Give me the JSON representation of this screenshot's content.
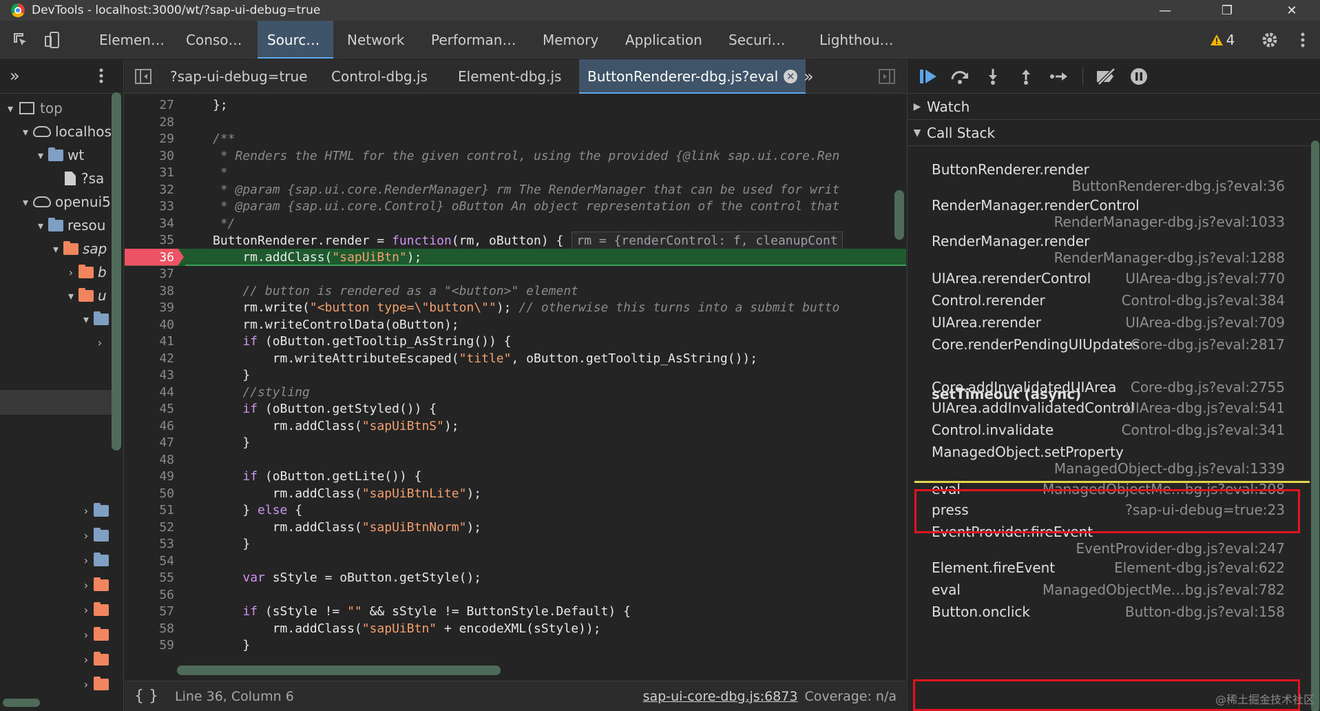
{
  "window": {
    "title": "DevTools - localhost:3000/wt/?sap-ui-debug=true",
    "controls": [
      "—",
      "❐",
      "✕"
    ]
  },
  "panel_tabs": [
    {
      "label": "Elemen…",
      "active": false
    },
    {
      "label": "Conso…",
      "active": false
    },
    {
      "label": "Sourc…",
      "active": true
    },
    {
      "label": "Network",
      "active": false
    },
    {
      "label": "Performan…",
      "active": false
    },
    {
      "label": "Memory",
      "active": false
    },
    {
      "label": "Application",
      "active": false
    },
    {
      "label": "Securi…",
      "active": false
    },
    {
      "label": "Lighthou…",
      "active": false
    }
  ],
  "warnings": {
    "icon": "warning-icon",
    "count": "4",
    "color": "#f4b400"
  },
  "navigator": {
    "more": "»",
    "tree": [
      {
        "label": "top",
        "icon": "frame-icon",
        "expanded": true
      },
      {
        "label": "localhos",
        "icon": "cloud-icon",
        "expanded": true
      },
      {
        "label": "wt",
        "icon": "folder-icon",
        "expanded": true
      },
      {
        "label": "?sa",
        "icon": "file-icon"
      },
      {
        "label": "openui5",
        "icon": "cloud-icon",
        "expanded": true
      },
      {
        "label": "resou",
        "icon": "folder-icon",
        "expanded": true
      },
      {
        "label": "sap",
        "icon": "folder-icon",
        "expanded": true
      },
      {
        "label": "b",
        "icon": "folder-icon",
        "expanded": false
      },
      {
        "label": "u",
        "icon": "folder-icon",
        "expanded": true
      }
    ]
  },
  "editor": {
    "tabs": [
      {
        "label": "?sap-ui-debug=true",
        "active": false
      },
      {
        "label": "Control-dbg.js",
        "active": false
      },
      {
        "label": "Element-dbg.js",
        "active": false
      },
      {
        "label": "ButtonRenderer-dbg.js?eval",
        "active": true
      }
    ],
    "more": "»",
    "status": {
      "braces": "{ }",
      "position": "Line 36, Column 6",
      "source_link": "sap-ui-core-dbg.js:6873",
      "coverage": "Coverage: n/a"
    }
  },
  "code": {
    "breakpoint_line": "36",
    "lines": [
      {
        "n": "27",
        "t": "};"
      },
      {
        "n": "28",
        "t": ""
      },
      {
        "n": "29",
        "t": "/**"
      },
      {
        "n": "30",
        "t": " * Renders the HTML for the given control, using the provided {@link sap.ui.core.Ren"
      },
      {
        "n": "31",
        "t": " *"
      },
      {
        "n": "32",
        "t": " * @param {sap.ui.core.RenderManager} rm The RenderManager that can be used for writ"
      },
      {
        "n": "33",
        "t": " * @param {sap.ui.core.Control} oButton An object representation of the control that"
      },
      {
        "n": "34",
        "t": " */"
      },
      {
        "n": "35",
        "t": "ButtonRenderer.render = function(rm, oButton) {"
      },
      {
        "n": "36",
        "t": "    rm.addClass(\"sapUiBtn\");"
      },
      {
        "n": "37",
        "t": ""
      },
      {
        "n": "38",
        "t": "    // button is rendered as a \"<button>\" element"
      },
      {
        "n": "39",
        "t": "    rm.write(\"<button type=\\\"button\\\"\"); // otherwise this turns into a submit butto"
      },
      {
        "n": "40",
        "t": "    rm.writeControlData(oButton);"
      },
      {
        "n": "41",
        "t": "    if (oButton.getTooltip_AsString()) {"
      },
      {
        "n": "42",
        "t": "        rm.writeAttributeEscaped(\"title\", oButton.getTooltip_AsString());"
      },
      {
        "n": "43",
        "t": "    }"
      },
      {
        "n": "44",
        "t": "    //styling"
      },
      {
        "n": "45",
        "t": "    if (oButton.getStyled()) {"
      },
      {
        "n": "46",
        "t": "        rm.addClass(\"sapUiBtnS\");"
      },
      {
        "n": "47",
        "t": "    }"
      },
      {
        "n": "48",
        "t": ""
      },
      {
        "n": "49",
        "t": "    if (oButton.getLite()) {"
      },
      {
        "n": "50",
        "t": "        rm.addClass(\"sapUiBtnLite\");"
      },
      {
        "n": "51",
        "t": "    } else {"
      },
      {
        "n": "52",
        "t": "        rm.addClass(\"sapUiBtnNorm\");"
      },
      {
        "n": "53",
        "t": "    }"
      },
      {
        "n": "54",
        "t": ""
      },
      {
        "n": "55",
        "t": "    var sStyle = oButton.getStyle();"
      },
      {
        "n": "56",
        "t": ""
      },
      {
        "n": "57",
        "t": "    if (sStyle != \"\" && sStyle != ButtonStyle.Default) {"
      },
      {
        "n": "58",
        "t": "        rm.addClass(\"sapUiBtn\" + encodeXML(sStyle));"
      },
      {
        "n": "59",
        "t": "    }"
      }
    ],
    "inline_value": "rm = {renderControl: f, cleanupCont"
  },
  "debugger": {
    "watch": "Watch",
    "callstack": "Call Stack",
    "async_label": "setTimeout (async)",
    "frames": [
      {
        "fn": "ButtonRenderer.render",
        "loc": "ButtonRenderer-dbg.js?eval:36"
      },
      {
        "fn": "RenderManager.renderControl",
        "loc": "RenderManager-dbg.js?eval:1033"
      },
      {
        "fn": "RenderManager.render",
        "loc": "RenderManager-dbg.js?eval:1288"
      },
      {
        "fn": "UIArea.rerenderControl",
        "loc": "UIArea-dbg.js?eval:770"
      },
      {
        "fn": "Control.rerender",
        "loc": "Control-dbg.js?eval:384"
      },
      {
        "fn": "UIArea.rerender",
        "loc": "UIArea-dbg.js?eval:709"
      },
      {
        "fn": "Core.renderPendingUIUpdates",
        "loc": "Core-dbg.js?eval:2817"
      },
      {
        "fn": "Core.addInvalidatedUIArea",
        "loc": "Core-dbg.js?eval:2755"
      },
      {
        "fn": "UIArea.addInvalidatedControl",
        "loc": "UIArea-dbg.js?eval:541"
      },
      {
        "fn": "Control.invalidate",
        "loc": "Control-dbg.js?eval:341"
      },
      {
        "fn": "ManagedObject.setProperty",
        "loc": "ManagedObject-dbg.js?eval:1339"
      },
      {
        "fn": "eval",
        "loc": "ManagedObjectMe…bg.js?eval:208"
      },
      {
        "fn": "press",
        "loc": "?sap-ui-debug=true:23"
      },
      {
        "fn": "EventProvider.fireEvent",
        "loc": "EventProvider-dbg.js?eval:247"
      },
      {
        "fn": "Element.fireEvent",
        "loc": "Element-dbg.js?eval:622"
      },
      {
        "fn": "eval",
        "loc": "ManagedObjectMe…bg.js?eval:782"
      },
      {
        "fn": "Button.onclick",
        "loc": "Button-dbg.js?eval:158"
      }
    ],
    "highlight_color": "#e4141e"
  },
  "watermark": "@稀土掘金技术社区"
}
